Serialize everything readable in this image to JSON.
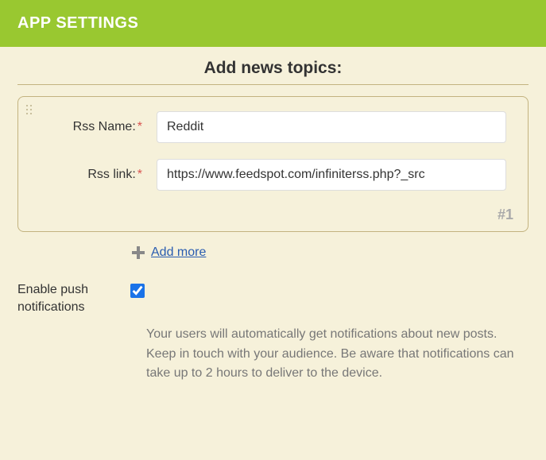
{
  "header": {
    "title": "APP SETTINGS"
  },
  "section": {
    "title": "Add news topics:"
  },
  "feed": {
    "index": "#1",
    "name_label": "Rss Name:",
    "name_value": "Reddit",
    "link_label": "Rss link:",
    "link_value": "https://www.feedspot.com/infiniterss.php?_src"
  },
  "add_more_label": "Add more",
  "push": {
    "label": "Enable push notifications",
    "checked": true,
    "description": "Your users will automatically get notifications about new posts. Keep in touch with your audience. Be aware that notifications can take up to 2 hours to deliver to the device."
  }
}
